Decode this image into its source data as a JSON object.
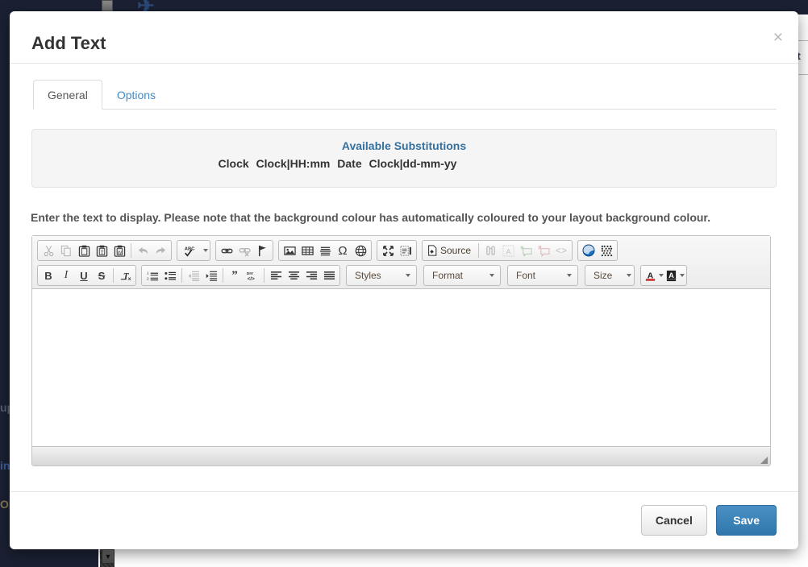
{
  "background": {
    "left_fragments": [
      "up",
      "ing",
      "ON"
    ],
    "right_fragment": "ast",
    "logo_text": "✈",
    "sidebar_color": "#1b2133",
    "backdrop_color": "#6e6e6e"
  },
  "modal": {
    "title": "Add Text",
    "close_label": "×",
    "tabs": [
      {
        "label": "General",
        "active": true
      },
      {
        "label": "Options",
        "active": false
      }
    ],
    "substitutions": {
      "title": "Available Substitutions",
      "items": [
        "Clock",
        "Clock|HH:mm",
        "Date",
        "Clock|dd-mm-yy"
      ]
    },
    "help_text": "Enter the text to display. Please note that the background colour has automatically coloured to your layout background colour.",
    "editor": {
      "content": "",
      "toolbar_rows": [
        {
          "groups": [
            {
              "buttons": [
                {
                  "icon": "cut-icon",
                  "title": "Cut",
                  "disabled": true
                },
                {
                  "icon": "copy-icon",
                  "title": "Copy",
                  "disabled": true
                },
                {
                  "icon": "paste-icon",
                  "title": "Paste",
                  "disabled": false
                },
                {
                  "icon": "paste-text-icon",
                  "title": "Paste as plain text",
                  "disabled": false
                },
                {
                  "icon": "paste-word-icon",
                  "title": "Paste from Word",
                  "disabled": false
                },
                {
                  "icon": "separator",
                  "title": "",
                  "disabled": false
                },
                {
                  "icon": "undo-icon",
                  "title": "Undo",
                  "disabled": true
                },
                {
                  "icon": "redo-icon",
                  "title": "Redo",
                  "disabled": true
                }
              ]
            },
            {
              "buttons": [
                {
                  "icon": "spellcheck-icon",
                  "title": "Spell Check As You Type",
                  "disabled": false,
                  "dropdown": true
                }
              ]
            },
            {
              "buttons": [
                {
                  "icon": "link-icon",
                  "title": "Link",
                  "disabled": false
                },
                {
                  "icon": "unlink-icon",
                  "title": "Unlink",
                  "disabled": true
                },
                {
                  "icon": "anchor-icon",
                  "title": "Anchor",
                  "disabled": false
                }
              ]
            },
            {
              "buttons": [
                {
                  "icon": "image-icon",
                  "title": "Image",
                  "disabled": false
                },
                {
                  "icon": "table-icon",
                  "title": "Table",
                  "disabled": false
                },
                {
                  "icon": "horizontal-rule-icon",
                  "title": "Horizontal Line",
                  "disabled": false
                },
                {
                  "icon": "special-char-icon",
                  "title": "Insert Special Character",
                  "disabled": false
                },
                {
                  "icon": "iframe-icon",
                  "title": "IFrame",
                  "disabled": false
                }
              ]
            },
            {
              "buttons": [
                {
                  "icon": "maximize-icon",
                  "title": "Maximize",
                  "disabled": false
                },
                {
                  "icon": "show-blocks-icon",
                  "title": "Show Blocks",
                  "disabled": false
                }
              ]
            },
            {
              "buttons": [
                {
                  "icon": "source-icon",
                  "title": "Source",
                  "label": "Source",
                  "disabled": false
                },
                {
                  "icon": "separator",
                  "title": "",
                  "disabled": false
                },
                {
                  "icon": "find-icon",
                  "title": "Find",
                  "disabled": true
                },
                {
                  "icon": "select-all-icon",
                  "title": "Select All",
                  "disabled": true
                },
                {
                  "icon": "add-comment-icon",
                  "title": "Add Comment",
                  "disabled": true
                },
                {
                  "icon": "remove-comment-icon",
                  "title": "Remove Comment",
                  "disabled": true
                },
                {
                  "icon": "code-icon",
                  "title": "Code",
                  "disabled": true
                }
              ]
            },
            {
              "buttons": [
                {
                  "icon": "globe-icon",
                  "title": "Browser Preview",
                  "disabled": false
                },
                {
                  "icon": "qrcode-icon",
                  "title": "QR Code",
                  "disabled": false
                }
              ]
            }
          ]
        },
        {
          "groups": [
            {
              "buttons": [
                {
                  "icon": "bold-icon",
                  "title": "Bold",
                  "label": "B",
                  "disabled": false
                },
                {
                  "icon": "italic-icon",
                  "title": "Italic",
                  "label": "I",
                  "disabled": false
                },
                {
                  "icon": "underline-icon",
                  "title": "Underline",
                  "label": "U",
                  "disabled": false
                },
                {
                  "icon": "strike-icon",
                  "title": "Strikethrough",
                  "label": "S",
                  "disabled": false
                },
                {
                  "icon": "separator",
                  "title": "",
                  "disabled": false
                },
                {
                  "icon": "remove-format-icon",
                  "title": "Remove Format",
                  "disabled": false
                }
              ]
            },
            {
              "buttons": [
                {
                  "icon": "numbered-list-icon",
                  "title": "Insert/Remove Numbered List",
                  "disabled": false
                },
                {
                  "icon": "bulleted-list-icon",
                  "title": "Insert/Remove Bulleted List",
                  "disabled": false
                },
                {
                  "icon": "separator",
                  "title": "",
                  "disabled": false
                },
                {
                  "icon": "outdent-icon",
                  "title": "Decrease Indent",
                  "disabled": true
                },
                {
                  "icon": "indent-icon",
                  "title": "Increase Indent",
                  "disabled": false
                },
                {
                  "icon": "separator",
                  "title": "",
                  "disabled": false
                },
                {
                  "icon": "blockquote-icon",
                  "title": "Block Quote",
                  "disabled": false
                },
                {
                  "icon": "div-container-icon",
                  "title": "Create Div Container",
                  "disabled": false
                },
                {
                  "icon": "separator",
                  "title": "",
                  "disabled": false
                },
                {
                  "icon": "align-left-icon",
                  "title": "Align Left",
                  "disabled": false
                },
                {
                  "icon": "align-center-icon",
                  "title": "Center",
                  "disabled": false
                },
                {
                  "icon": "align-right-icon",
                  "title": "Align Right",
                  "disabled": false
                },
                {
                  "icon": "align-justify-icon",
                  "title": "Justify",
                  "disabled": false
                }
              ]
            }
          ],
          "combos": [
            {
              "name": "styles",
              "label": "Styles"
            },
            {
              "name": "format",
              "label": "Format"
            },
            {
              "name": "font",
              "label": "Font"
            },
            {
              "name": "size",
              "label": "Size"
            }
          ],
          "color_buttons": [
            {
              "icon": "text-color-icon",
              "title": "Text Color",
              "label": "A"
            },
            {
              "icon": "bg-color-icon",
              "title": "Background Color",
              "label": "A"
            }
          ]
        }
      ]
    },
    "footer": {
      "cancel_label": "Cancel",
      "save_label": "Save"
    }
  },
  "colors": {
    "accent_blue": "#36709c",
    "primary_button": "#2f77ac",
    "tab_link": "#428bca",
    "well_bg": "#f5f5f5"
  }
}
